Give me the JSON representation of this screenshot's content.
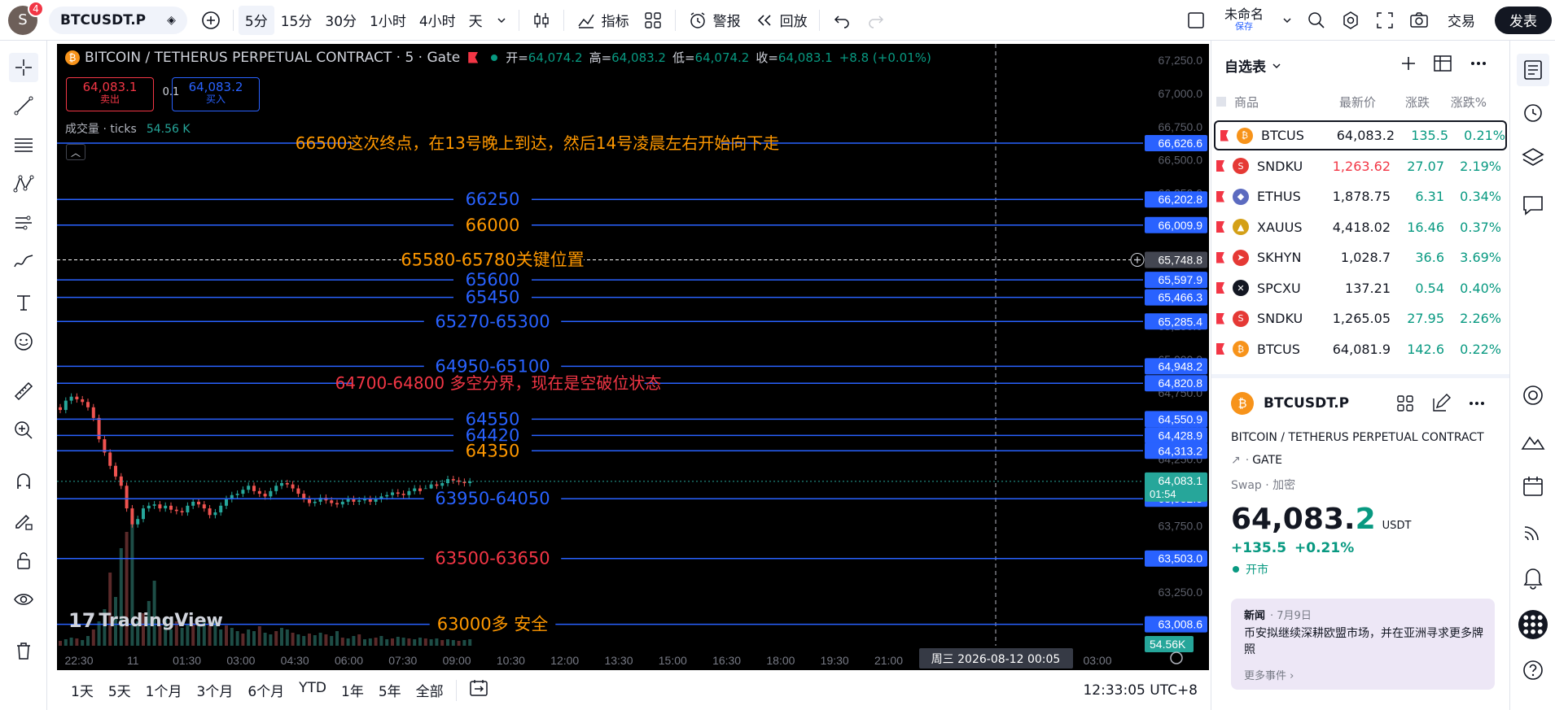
{
  "topbar": {
    "avatar_letter": "S",
    "notif_count": "4",
    "symbol": "BTCUSDT.P",
    "intervals": [
      "5分",
      "15分",
      "30分",
      "1小时",
      "4小时",
      "天"
    ],
    "active_interval": "5分",
    "indicators": "指标",
    "alert": "警报",
    "replay": "回放",
    "layout_name": "未命名",
    "layout_sub": "保存",
    "trade": "交易",
    "publish": "发表"
  },
  "legend": {
    "title": "BITCOIN / TETHERUS PERPETUAL CONTRACT · 5 · Gate",
    "o_label": "开=",
    "o": "64,074.2",
    "h_label": "高=",
    "h": "64,083.2",
    "l_label": "低=",
    "l": "64,074.2",
    "c_label": "收=",
    "c": "64,083.1",
    "change": "+8.8 (+0.01%)",
    "sell_price": "64,083.1",
    "sell_label": "卖出",
    "spread": "0.1",
    "buy_price": "64,083.2",
    "buy_label": "买入",
    "volume_label": "成交量 · ticks",
    "volume_value": "54.56 K"
  },
  "chart_data": {
    "type": "candlestick",
    "y_range": [
      63000,
      67250
    ],
    "y_ticks": [
      "67,250.0",
      "67,000.0",
      "66,750.0",
      "66,500.0",
      "66,250.0",
      "66,000.0",
      "65,750.0",
      "65,500.0",
      "65,250.0",
      "65,000.0",
      "64,750.0",
      "64,500.0",
      "64,250.0",
      "64,000.0",
      "63,750.0",
      "63,500.0",
      "63,250.0",
      "63,000.0"
    ],
    "x_ticks": [
      "22:30",
      "11",
      "01:30",
      "03:00",
      "04:30",
      "06:00",
      "07:30",
      "09:00",
      "10:30",
      "12:00",
      "13:30",
      "15:00",
      "16:30",
      "18:00",
      "19:30",
      "21:00",
      "03:00"
    ],
    "crosshair_date": "周三 2026-08-12   00:05",
    "last_price": "64,083.1",
    "countdown": "01:54",
    "volume_badge": "54.56K",
    "crosshair_price": "65,748.8",
    "levels": [
      {
        "price": 66626.6,
        "label": "66,626.6",
        "text": "66500这次终点，在13号晚上到达，然后14号凌晨左右开始向下走",
        "color": "#ff9800",
        "dashed": false
      },
      {
        "price": 66202.8,
        "label": "66,202.8",
        "text": "66250",
        "color": "#2962ff",
        "dashed": false
      },
      {
        "price": 66009.9,
        "label": "66,009.9",
        "text": "66000",
        "color": "#ff9800",
        "dashed": false
      },
      {
        "price": 65748.8,
        "label": "65,748.8",
        "text": "65580-65780关键位置",
        "color": "#ff9800",
        "dashed": true
      },
      {
        "price": 65597.9,
        "label": "65,597.9",
        "text": "65600",
        "color": "#2962ff",
        "dashed": false
      },
      {
        "price": 65466.3,
        "label": "65,466.3",
        "text": "65450",
        "color": "#2962ff",
        "dashed": false
      },
      {
        "price": 65285.4,
        "label": "65,285.4",
        "text": "65270-65300",
        "color": "#2962ff",
        "dashed": false
      },
      {
        "price": 64948.2,
        "label": "64,948.2",
        "text": "64950-65100",
        "color": "#2962ff",
        "dashed": false
      },
      {
        "price": 64820.8,
        "label": "64,820.8",
        "text": "64700-64800  多空分界，现在是空破位状态",
        "color": "#f23645",
        "dashed": false
      },
      {
        "price": 64550.9,
        "label": "64,550.9",
        "text": "64550",
        "color": "#2962ff",
        "dashed": false
      },
      {
        "price": 64428.9,
        "label": "64,428.9",
        "text": "64420",
        "color": "#2962ff",
        "dashed": false
      },
      {
        "price": 64313.2,
        "label": "64,313.2",
        "text": "64350",
        "color": "#ff9800",
        "dashed": false
      },
      {
        "price": 63952.5,
        "label": "63,952.5",
        "text": "63950-64050",
        "color": "#2962ff",
        "dashed": false
      },
      {
        "price": 63503.0,
        "label": "63,503.0",
        "text": "63500-63650",
        "color": "#f23645",
        "dashed": false
      },
      {
        "price": 63008.6,
        "label": "63,008.6",
        "text": "63000多  安全",
        "color": "#ff9800",
        "dashed": false
      }
    ],
    "candles": [
      64620,
      64690,
      64720,
      64700,
      64680,
      64640,
      64560,
      64400,
      64300,
      64200,
      64120,
      64050,
      63880,
      63760,
      63800,
      63880,
      63900,
      63910,
      63880,
      63900,
      63870,
      63860,
      63850,
      63900,
      63930,
      63910,
      63880,
      63830,
      63850,
      63900,
      63950,
      63980,
      63990,
      64020,
      64050,
      64010,
      63990,
      63970,
      64010,
      64050,
      64070,
      64060,
      64030,
      63990,
      63950,
      63920,
      63930,
      63960,
      63940,
      63920,
      63910,
      63930,
      63950,
      63930,
      63940,
      63950,
      63930,
      63950,
      63970,
      63980,
      64000,
      63990,
      63980,
      64010,
      64030,
      64010,
      64030,
      64060,
      64050,
      64070,
      64100,
      64090,
      64080,
      64070,
      64083
    ]
  },
  "watermark": "TradingView",
  "bottom": {
    "ranges": [
      "1天",
      "5天",
      "1个月",
      "3个月",
      "6个月",
      "YTD",
      "1年",
      "5年",
      "全部"
    ],
    "clock": "12:33:05 UTC+8"
  },
  "watchlist": {
    "title": "自选表",
    "cols": [
      "商品",
      "最新价",
      "涨跌",
      "涨跌%"
    ],
    "rows": [
      {
        "sym": "BTCUS",
        "last": "64,083.2",
        "chg": "135.5",
        "chgp": "0.21%",
        "color": "#f7931a",
        "glyph": "₿",
        "selected": true
      },
      {
        "sym": "SNDKU",
        "last": "1,263.62",
        "chg": "27.07",
        "chgp": "2.19%",
        "color": "#e53935",
        "glyph": "S",
        "red": true
      },
      {
        "sym": "ETHUS",
        "last": "1,878.75",
        "chg": "6.31",
        "chgp": "0.34%",
        "color": "#5c6bc0",
        "glyph": "◆"
      },
      {
        "sym": "XAUUS",
        "last": "4,418.02",
        "chg": "16.46",
        "chgp": "0.37%",
        "color": "#d4a017",
        "glyph": "▲"
      },
      {
        "sym": "SKHYN",
        "last": "1,028.7",
        "chg": "36.6",
        "chgp": "3.69%",
        "color": "#e53935",
        "glyph": "➤"
      },
      {
        "sym": "SPCXU",
        "last": "137.21",
        "chg": "0.54",
        "chgp": "0.40%",
        "color": "#131722",
        "glyph": "✕"
      },
      {
        "sym": "SNDKU",
        "last": "1,265.05",
        "chg": "27.95",
        "chgp": "2.26%",
        "color": "#e53935",
        "glyph": "S"
      },
      {
        "sym": "BTCUS",
        "last": "64,081.9",
        "chg": "142.6",
        "chgp": "0.22%",
        "color": "#f7931a",
        "glyph": "₿"
      }
    ]
  },
  "details": {
    "symbol": "BTCUSDT.P",
    "fullname": "BITCOIN / TETHERUS PERPETUAL CONTRACT",
    "exchange": "GATE",
    "type": "Swap · 加密",
    "price_main": "64,083.",
    "price_last": "2",
    "currency": "USDT",
    "change": "+135.5",
    "change_pct": "+0.21%",
    "market_status": "开市",
    "news_label": "新闻",
    "news_date": "· 7月9日",
    "news_text": "币安拟继续深耕欧盟市场，并在亚洲寻求更多牌照",
    "more_events": "更多事件 ›"
  }
}
